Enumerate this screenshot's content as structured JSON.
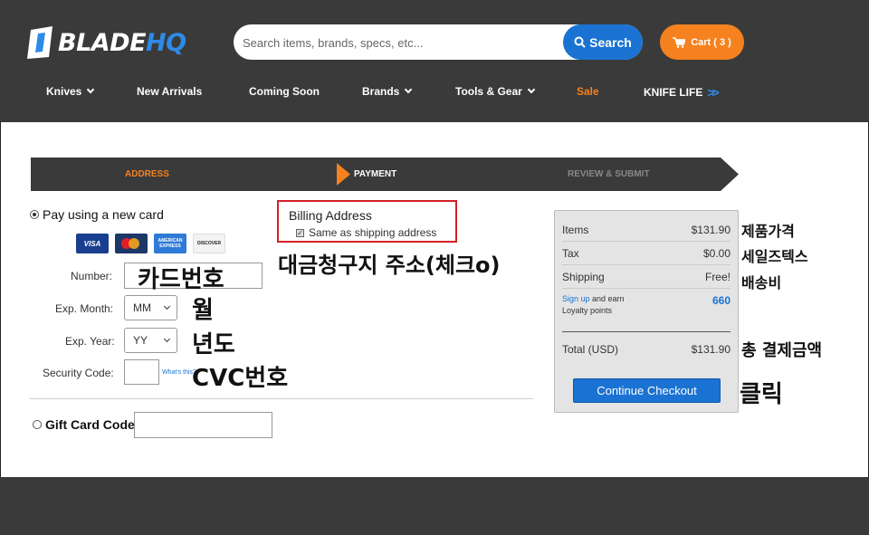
{
  "header": {
    "logo": {
      "blade": "BLADE",
      "hq": "HQ"
    },
    "search": {
      "placeholder": "Search items, brands, specs, etc...",
      "button_label": "Search"
    },
    "cart_label": "Cart ( 3 )",
    "nav": [
      {
        "label": "Knives",
        "dropdown": true
      },
      {
        "label": "New Arrivals",
        "dropdown": false
      },
      {
        "label": "Coming Soon",
        "dropdown": false
      },
      {
        "label": "Brands",
        "dropdown": true
      },
      {
        "label": "Tools & Gear",
        "dropdown": true
      },
      {
        "label": "Sale",
        "dropdown": false
      },
      {
        "label": "KNIFE LIFE",
        "dropdown": false
      }
    ],
    "knife_life_arrows": ">>"
  },
  "steps": {
    "address": "ADDRESS",
    "payment": "PAYMENT",
    "review": "REVIEW & SUBMIT",
    "active": "PAYMENT"
  },
  "payment": {
    "new_card_label": "Pay using a new card",
    "cards": [
      "VISA",
      "MasterCard",
      "AMERICAN EXPRESS",
      "DISCOVER"
    ],
    "number_label": "Number:",
    "exp_month_label": "Exp. Month:",
    "exp_month_value": "MM",
    "exp_year_label": "Exp. Year:",
    "exp_year_value": "YY",
    "security_label": "Security Code:",
    "whats_this": "What's this?",
    "gift_label": "Gift Card Code:"
  },
  "billing": {
    "title": "Billing Address",
    "same_as_shipping": "Same as shipping address",
    "checked": true
  },
  "summary": {
    "items_label": "Items",
    "items_value": "$131.90",
    "tax_label": "Tax",
    "tax_value": "$0.00",
    "shipping_label": "Shipping",
    "shipping_value": "Free!",
    "signup_link": "Sign up",
    "signup_rest": " and earn",
    "loyalty": "Loyalty points",
    "points": "660",
    "total_label": "Total (USD)",
    "total_value": "$131.90",
    "checkout_label": "Continue Checkout"
  },
  "annotations": {
    "card_number": "카드번호",
    "month": "월",
    "year": "년도",
    "cvc": "CVC번호",
    "billing": "대금청구지 주소(체크o)",
    "product_price": "제품가격",
    "sales_tax": "세일즈텍스",
    "shipping": "배송비",
    "total": "총 결제금액",
    "click": "클릭"
  },
  "colors": {
    "header_bg": "#3a3a3a",
    "brand_blue": "#1a73d2",
    "accent_orange": "#f5821f",
    "highlight_red": "#d32027"
  }
}
